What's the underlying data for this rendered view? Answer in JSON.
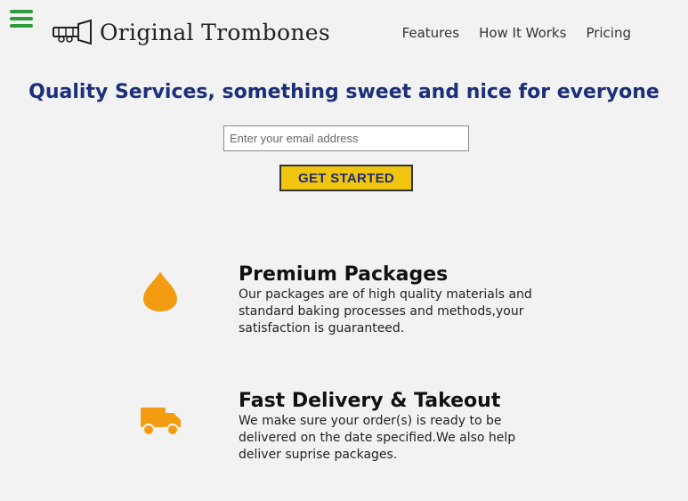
{
  "header": {
    "brand": "Original Trombones",
    "nav": [
      {
        "label": "Features"
      },
      {
        "label": "How It Works"
      },
      {
        "label": "Pricing"
      }
    ]
  },
  "hero": {
    "title": "Quality Services, something sweet and nice for everyone",
    "email_placeholder": "Enter your email address",
    "cta_label": "GET STARTED"
  },
  "features": [
    {
      "icon": "fire-icon",
      "title": "Premium Packages",
      "text": "Our packages are of high quality materials and standard baking processes and methods,your satisfaction is guaranteed."
    },
    {
      "icon": "truck-icon",
      "title": "Fast Delivery & Takeout",
      "text": "We make sure your order(s) is ready to be delivered on the date specified.We also help deliver suprise packages."
    }
  ],
  "colors": {
    "accent_icon": "#f39c12",
    "menu_icon": "#2e9a3e",
    "cta_bg": "#f1c40f",
    "title": "#1b2f7a"
  }
}
